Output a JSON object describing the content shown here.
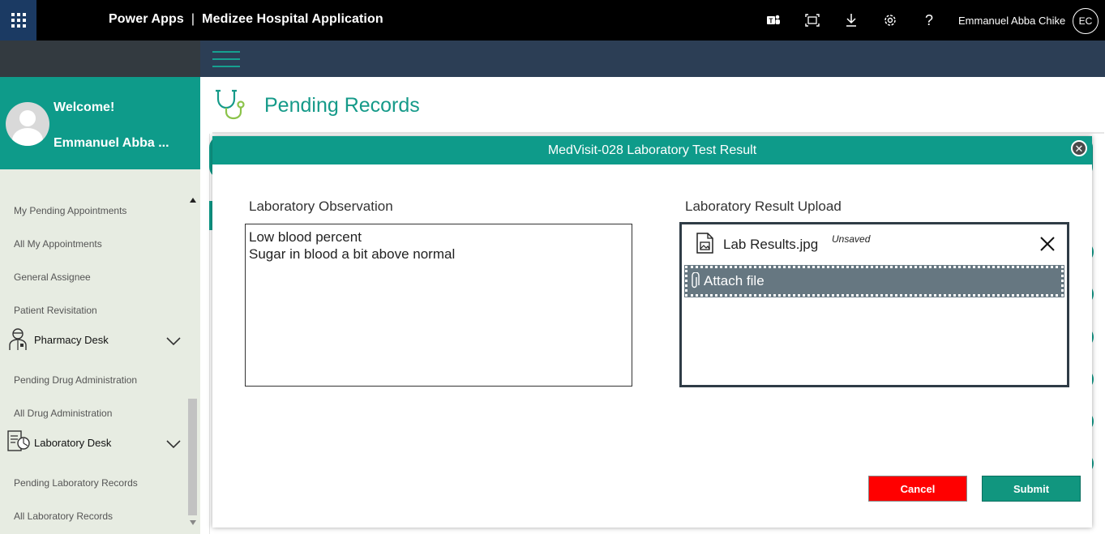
{
  "topbar": {
    "app_name": "Power Apps",
    "separator": "|",
    "app_title": "Medizee Hospital Application",
    "icons": [
      "waffle-icon",
      "teams-icon",
      "fit-screen-icon",
      "download-icon",
      "settings-icon",
      "help-icon"
    ],
    "help_glyph": "?",
    "user_name": "Emmanuel Abba Chike",
    "user_initials": "EC"
  },
  "sidebar": {
    "welcome": "Welcome!",
    "user_name": "Emmanuel Abba ...",
    "items": [
      {
        "label": "My Pending Appointments"
      },
      {
        "label": "All My Appointments"
      },
      {
        "label": "General Assignee"
      },
      {
        "label": "Patient Revisitation"
      },
      {
        "label": "Pharmacy Desk",
        "group": true,
        "icon": "pharmacist-icon"
      },
      {
        "label": "Pending Drug Administration"
      },
      {
        "label": "All Drug Administration"
      },
      {
        "label": "Laboratory Desk",
        "group": true,
        "icon": "lab-report-icon"
      },
      {
        "label": "Pending Laboratory Records"
      },
      {
        "label": "All Laboratory Records"
      }
    ]
  },
  "page": {
    "title": "Pending Records",
    "icon": "stethoscope-icon"
  },
  "dialog": {
    "title": "MedVisit-028 Laboratory Test Result",
    "observation_label": "Laboratory Observation",
    "observation_lines": [
      "Low blood percent",
      "Sugar in blood a bit above normal"
    ],
    "upload_label": "Laboratory Result Upload",
    "file_name": "Lab Results.jpg",
    "file_status": "Unsaved",
    "attach_label": "Attach file",
    "cancel_label": "Cancel",
    "submit_label": "Submit"
  },
  "colors": {
    "brand_teal": "#0e9b8a",
    "topbar": "#000000",
    "subheader": "#2c3e55",
    "cancel": "#ff0000",
    "submit": "#11967f",
    "attach_bg": "#667781"
  }
}
